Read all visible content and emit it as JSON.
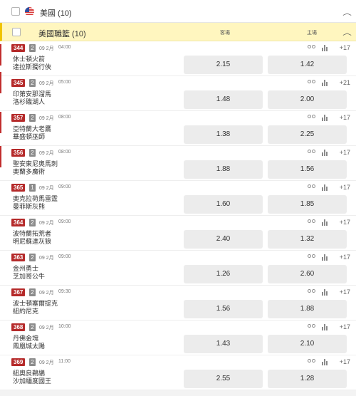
{
  "country": {
    "label": "美國 (10)",
    "flag": "us-flag-icon"
  },
  "league": {
    "label": "美國職籃 (10)",
    "home_col": "客場",
    "away_col": "主場"
  },
  "matches": [
    {
      "id": "344",
      "n": "2",
      "date": "09 2月",
      "time": "04:00",
      "home": "休士頓火箭",
      "away": "達拉斯獨行俠",
      "odds_home": "2.15",
      "odds_away": "1.42",
      "more": "+17"
    },
    {
      "id": "345",
      "n": "2",
      "date": "09 2月",
      "time": "05:00",
      "home": "印第安那溜馬",
      "away": "洛杉磯湖人",
      "odds_home": "1.48",
      "odds_away": "2.00",
      "more": "+21"
    },
    {
      "id": "357",
      "n": "2",
      "date": "09 2月",
      "time": "08:00",
      "home": "亞特蘭大老鷹",
      "away": "華盛頓巫師",
      "odds_home": "1.38",
      "odds_away": "2.25",
      "more": "+17"
    },
    {
      "id": "356",
      "n": "2",
      "date": "09 2月",
      "time": "08:00",
      "home": "聖安東尼奧馬刺",
      "away": "奧蘭多魔術",
      "odds_home": "1.88",
      "odds_away": "1.56",
      "more": "+17"
    },
    {
      "id": "365",
      "n": "1",
      "date": "09 2月",
      "time": "09:00",
      "home": "奧克拉荷馬雷霆",
      "away": "曼菲斯灰熊",
      "odds_home": "1.60",
      "odds_away": "1.85",
      "more": "+17"
    },
    {
      "id": "364",
      "n": "2",
      "date": "09 2月",
      "time": "09:00",
      "home": "波特蘭拓荒者",
      "away": "明尼蘇達灰狼",
      "odds_home": "2.40",
      "odds_away": "1.32",
      "more": "+17"
    },
    {
      "id": "363",
      "n": "2",
      "date": "09 2月",
      "time": "09:00",
      "home": "金州勇士",
      "away": "芝加哥公牛",
      "odds_home": "1.26",
      "odds_away": "2.60",
      "more": "+17"
    },
    {
      "id": "367",
      "n": "2",
      "date": "09 2月",
      "time": "09:30",
      "home": "波士頓塞爾提克",
      "away": "紐約尼克",
      "odds_home": "1.56",
      "odds_away": "1.88",
      "more": "+17"
    },
    {
      "id": "368",
      "n": "2",
      "date": "09 2月",
      "time": "10:00",
      "home": "丹佛金塊",
      "away": "鳳凰城太陽",
      "odds_home": "1.43",
      "odds_away": "2.10",
      "more": "+17"
    },
    {
      "id": "369",
      "n": "2",
      "date": "09 2月",
      "time": "11:00",
      "home": "紐奧良鵜鶘",
      "away": "沙加緬度國王",
      "odds_home": "2.55",
      "odds_away": "1.28",
      "more": "+17"
    }
  ],
  "icons": {
    "field": "field-icon",
    "stats": "stats-bars-icon",
    "chevron_up": "chevron-up-icon"
  },
  "colors": {
    "league_bg": "#fff6bf",
    "league_accent": "#f0c400",
    "id_badge": "#b52a2a",
    "odds_bg": "#ececec"
  }
}
